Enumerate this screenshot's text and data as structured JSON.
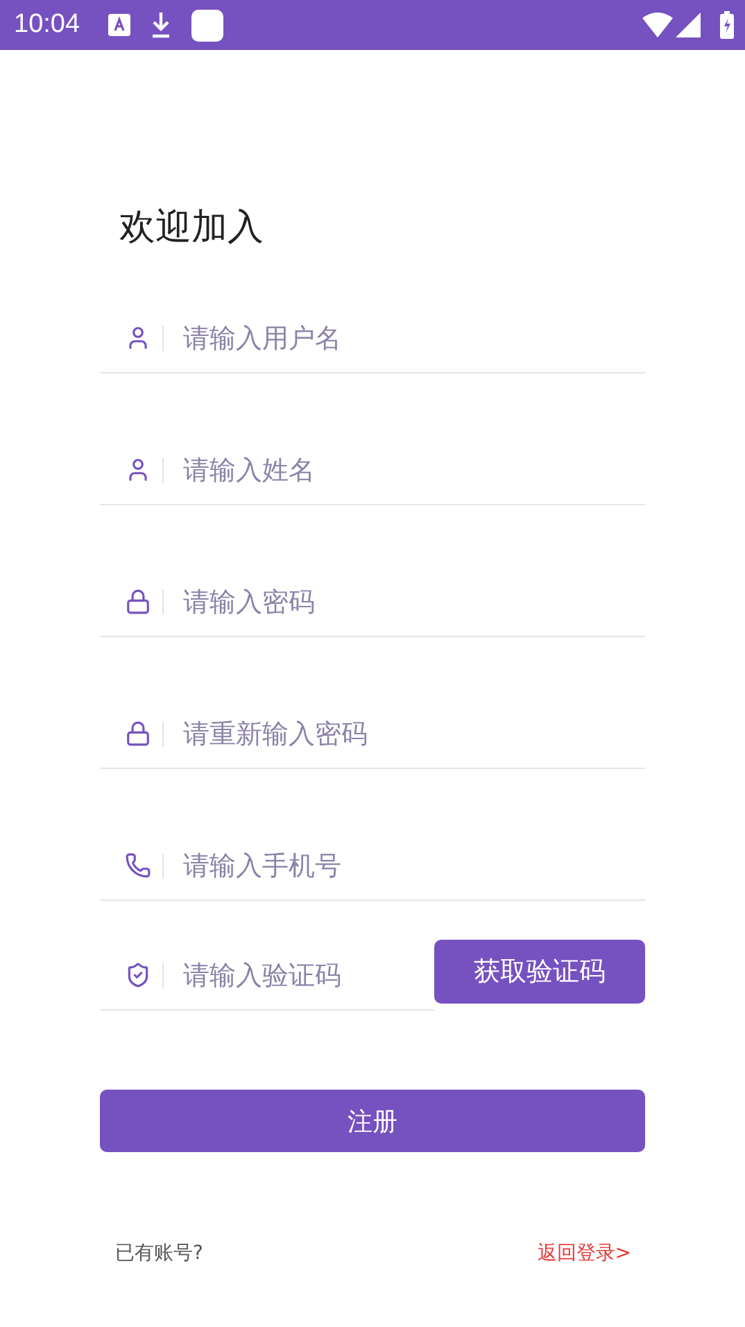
{
  "status_bar": {
    "time": "10:04"
  },
  "title": "欢迎加入",
  "fields": [
    {
      "kind": "user",
      "placeholder": "请输入用户名"
    },
    {
      "kind": "user",
      "placeholder": "请输入姓名"
    },
    {
      "kind": "lock",
      "placeholder": "请输入密码"
    },
    {
      "kind": "lock",
      "placeholder": "请重新输入密码"
    },
    {
      "kind": "phone",
      "placeholder": "请输入手机号"
    }
  ],
  "code_field": {
    "kind": "shield",
    "placeholder": "请输入验证码",
    "button": "获取验证码"
  },
  "register_button": "注册",
  "footer": {
    "prompt": "已有账号?",
    "link": "返回登录>"
  }
}
